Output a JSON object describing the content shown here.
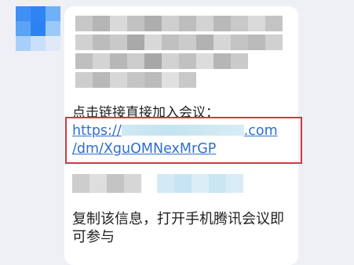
{
  "message": {
    "instruction": "点击链接直接加入会议：",
    "link": {
      "prefix": "https://",
      "suffix": ".com",
      "path": "/dm/XguOMNexMrGP"
    },
    "copy_hint": "复制该信息，打开手机腾讯会议即可参与"
  },
  "colors": {
    "background": "#eef0f5",
    "bubble": "#ffffff",
    "link": "#2f6fd0",
    "highlight": "#d9363e"
  }
}
